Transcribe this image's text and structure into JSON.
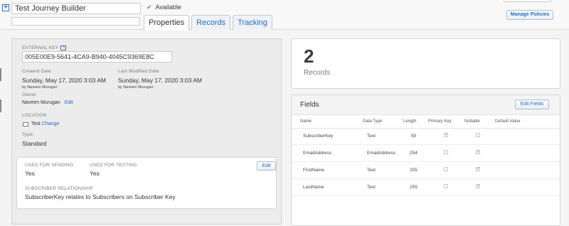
{
  "header": {
    "name_value": "Test Journey Builder",
    "status_label": "Available",
    "tabs": [
      {
        "label": "Properties",
        "active": true
      },
      {
        "label": "Records",
        "active": false
      },
      {
        "label": "Tracking",
        "active": false
      }
    ],
    "manage_policies_label": "Manage Policies"
  },
  "properties": {
    "external_key_label": "EXTERNAL KEY",
    "external_key_help": "?",
    "external_key_value": "005E00E9-5641-4CA9-B940-4045C9369E8C",
    "created_date_label": "Created Date",
    "created_date_value": "Sunday, May 17, 2020 3:03 AM",
    "created_by": "by Naveen Murugan",
    "modified_date_label": "Last Modified Date",
    "modified_date_value": "Sunday, May 17, 2020 3:03 AM",
    "modified_by": "by Naveen Murugan",
    "owner_label": "Owner",
    "owner_value": "Naveen Murugan",
    "owner_edit_label": "Edit",
    "location_label": "LOCATION",
    "location_value": "Test",
    "location_change_label": "Change",
    "type_label": "Type:",
    "type_value": "Standard",
    "sending_label": "USED FOR SENDING",
    "sending_value": "Yes",
    "testing_label": "USED FOR TESTING",
    "testing_value": "Yes",
    "subscriber_rel_label": "SUBSCRIBER RELATIONSHIP",
    "subscriber_rel_value": "SubscriberKey relates to Subscribers on Subscriber Key",
    "edit_label": "Edit"
  },
  "records": {
    "count": "2",
    "label": "Records"
  },
  "fields": {
    "title": "Fields",
    "edit_fields_label": "Edit Fields",
    "columns": [
      "Name",
      "Data Type",
      "Length",
      "Primary Key",
      "Nullable",
      "Default Value"
    ],
    "rows": [
      {
        "name": "SubscriberKey",
        "type": "Text",
        "length": "50",
        "primary_key": true,
        "nullable": false
      },
      {
        "name": "EmailAddress",
        "type": "EmailAddress",
        "length": "254",
        "primary_key": false,
        "nullable": true
      },
      {
        "name": "FirstName",
        "type": "Text",
        "length": "255",
        "primary_key": false,
        "nullable": true
      },
      {
        "name": "LastName",
        "type": "Text",
        "length": "255",
        "primary_key": false,
        "nullable": true
      }
    ]
  },
  "colors": {
    "link": "#2a6ebb",
    "available_check": "#4aa64a"
  },
  "icons": {
    "add": "add-icon",
    "check": "check-icon",
    "help": "help-icon",
    "folder": "folder-icon",
    "checkbox": "checkbox-icon"
  }
}
